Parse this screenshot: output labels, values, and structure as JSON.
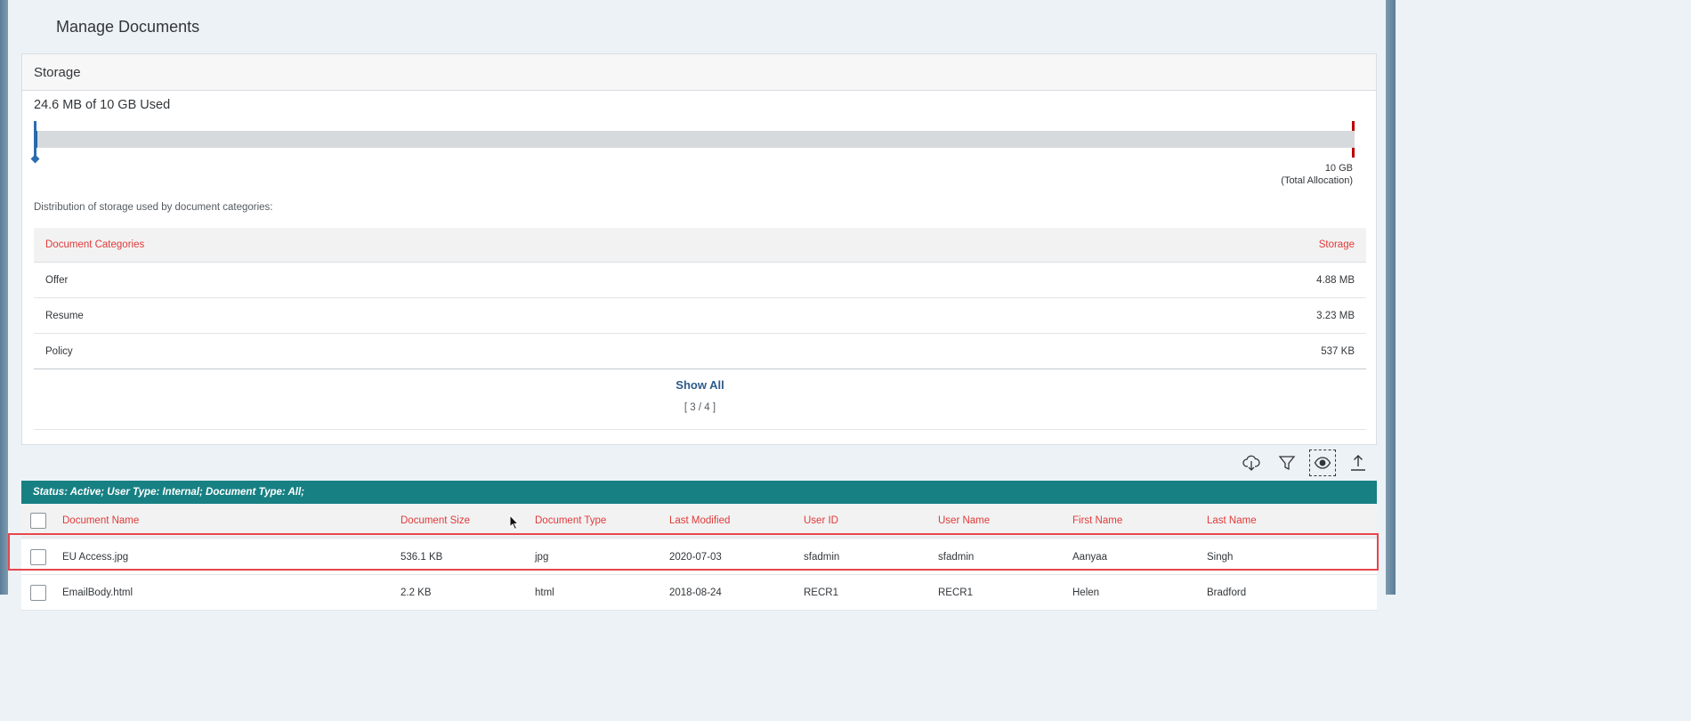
{
  "page": {
    "title": "Manage Documents"
  },
  "storage": {
    "header": "Storage",
    "usage_text": "24.6 MB of 10 GB Used",
    "used_fraction": 0.0024,
    "alloc_value": "10 GB",
    "alloc_note": "(Total Allocation)",
    "distribution_label": "Distribution of storage used by document categories:",
    "table": {
      "col_category": "Document Categories",
      "col_storage": "Storage",
      "rows": [
        {
          "category": "Offer",
          "storage": "4.88 MB"
        },
        {
          "category": "Resume",
          "storage": "3.23 MB"
        },
        {
          "category": "Policy",
          "storage": "537 KB"
        }
      ]
    },
    "show_all": "Show All",
    "count": "[ 3 / 4 ]"
  },
  "toolbar": {
    "icons": [
      "cloud-download-icon",
      "filter-icon",
      "eye-icon",
      "upload-icon"
    ]
  },
  "filter_bar": {
    "text": "Status: Active; User Type: Internal; Document Type: All;"
  },
  "documents": {
    "columns": [
      "Document Name",
      "Document Size",
      "Document Type",
      "Last Modified",
      "User ID",
      "User Name",
      "First Name",
      "Last Name"
    ],
    "rows": [
      [
        "EU Access.jpg",
        "536.1 KB",
        "jpg",
        "2020-07-03",
        "sfadmin",
        "sfadmin",
        "Aanyaa",
        "Singh"
      ],
      [
        "EmailBody.html",
        "2.2 KB",
        "html",
        "2018-08-24",
        "RECR1",
        "RECR1",
        "Helen",
        "Bradford"
      ]
    ]
  },
  "colors": {
    "accent": "#178083",
    "header_text": "#e03a3a",
    "usage_bar": "#1f5d9c",
    "limit": "#bb0000",
    "selection": "#e8464c"
  }
}
